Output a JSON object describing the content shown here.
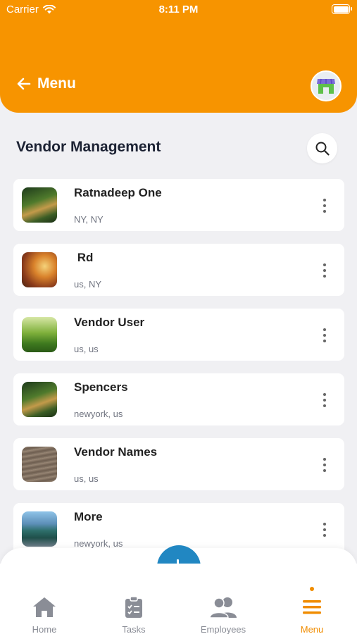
{
  "status_bar": {
    "carrier": "Carrier",
    "time": "8:11 PM"
  },
  "header": {
    "back_label": "Menu",
    "avatar_icon": "store-icon"
  },
  "page": {
    "title": "Vendor Management",
    "search_icon": "search-icon"
  },
  "vendors": [
    {
      "name": "Ratnadeep One",
      "location": "NY, NY"
    },
    {
      "name": " Rd",
      "location": "us, NY"
    },
    {
      "name": "Vendor User",
      "location": "us, us"
    },
    {
      "name": "Spencers",
      "location": "newyork, us"
    },
    {
      "name": "Vendor Names",
      "location": "us, us"
    },
    {
      "name": "More",
      "location": "newyork, us"
    }
  ],
  "nav": {
    "items": [
      {
        "label": "Home",
        "icon": "home-icon"
      },
      {
        "label": "Tasks",
        "icon": "clipboard-icon"
      },
      {
        "label": "Employees",
        "icon": "people-icon"
      },
      {
        "label": "Menu",
        "icon": "hamburger-icon",
        "active": true
      }
    ]
  },
  "colors": {
    "brand": "#f79400",
    "accent_blue": "#2187c2",
    "active_nav": "#f08c00"
  }
}
